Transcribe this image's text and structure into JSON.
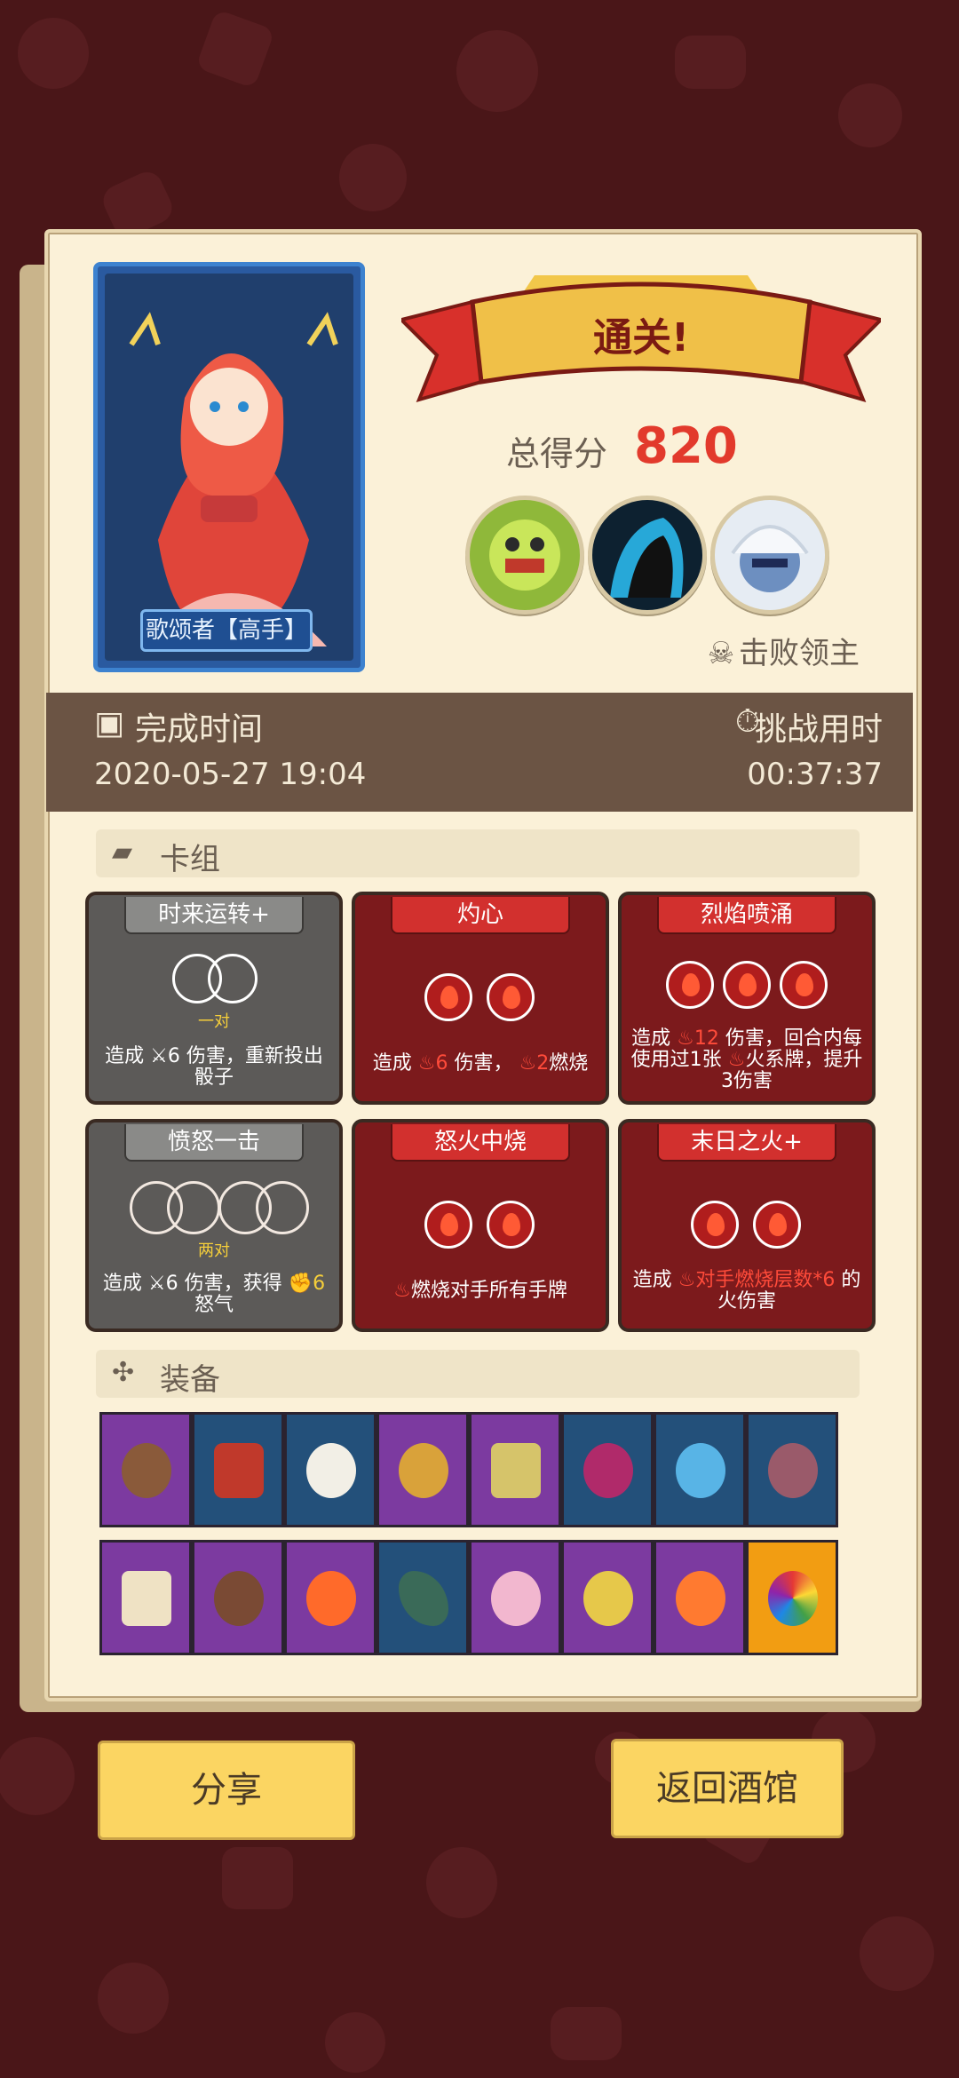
{
  "hero": {
    "name": "歌颂者【高手】"
  },
  "result": {
    "banner": "通关!",
    "score_label": "总得分",
    "score": "820"
  },
  "bosses": [
    "boss-plant-icon",
    "boss-shadow-icon",
    "boss-yeti-icon"
  ],
  "defeat_label": "击败领主",
  "time": {
    "finish_label": "完成时间",
    "finish_value": "2020-05-27 19:04",
    "duration_label": "挑战用时",
    "duration_value": "00:37:37"
  },
  "deck": {
    "title": "卡组",
    "cards": [
      {
        "name": "时来运转+",
        "sub": "一对",
        "desc_a": "造成",
        "dmg": "6",
        "desc_b": "伤害，重新投出骰子"
      },
      {
        "name": "灼心",
        "desc_a": "造成",
        "dmg": "6",
        "desc_b": "伤害，",
        "burn": "2",
        "desc_c": "燃烧"
      },
      {
        "name": "烈焰喷涌",
        "desc_a": "造成",
        "dmg": "12",
        "desc_b": "伤害，回合内每使用过1张",
        "desc_c": "火系牌，提升3伤害"
      },
      {
        "name": "愤怒一击",
        "sub": "两对",
        "desc_a": "造成",
        "dmg": "6",
        "desc_b": "伤害，获得",
        "rage": "6",
        "desc_c": "怒气"
      },
      {
        "name": "怒火中烧",
        "desc_a": "燃烧对手所有手牌"
      },
      {
        "name": "末日之火+",
        "desc_a": "造成",
        "hl": "对手燃烧层数*6",
        "desc_b": "的火伤害"
      }
    ]
  },
  "equipment": {
    "title": "装备",
    "row1": [
      "fire-rune-icon",
      "red-shield-icon",
      "skull-rocket-icon",
      "blood-ring-icon",
      "skull-book-icon",
      "gem-amulet-icon",
      "ice-crown-icon",
      "spiral-shield-icon"
    ],
    "row2": [
      "skull-scroll-icon",
      "burning-stone-icon",
      "fire-icon",
      "dagger-icon",
      "crystal-dice-icon",
      "heart-stone-icon",
      "campfire-icon",
      "rainbow-orb-icon"
    ]
  },
  "buttons": {
    "share": "分享",
    "back": "返回酒馆"
  }
}
